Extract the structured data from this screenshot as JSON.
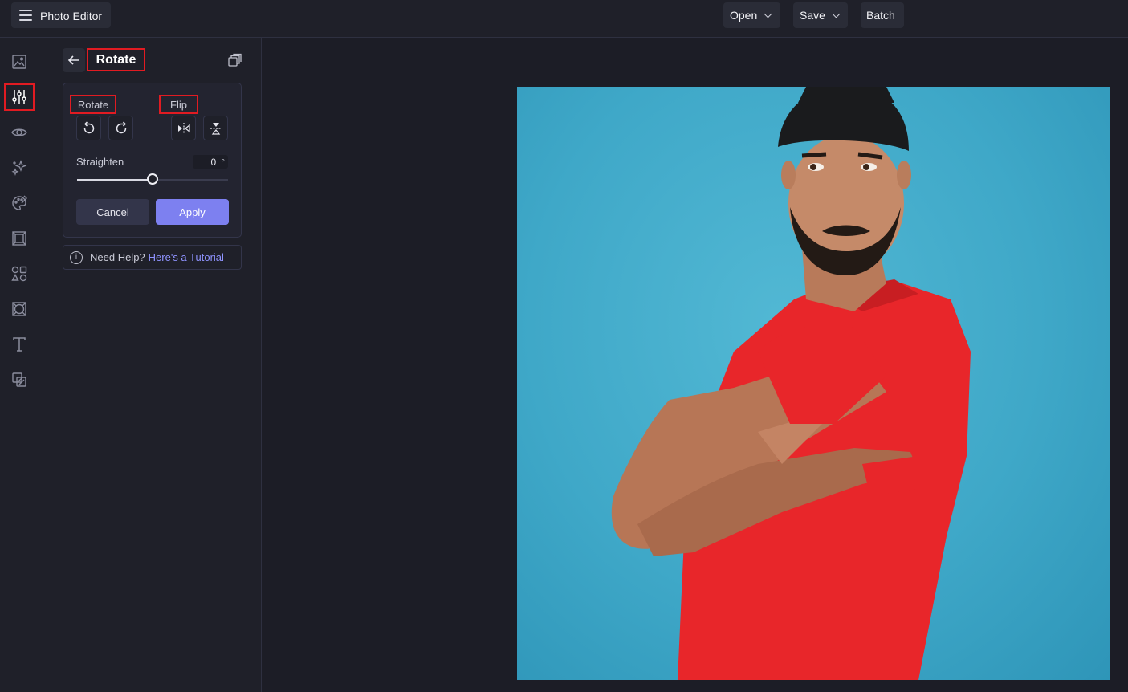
{
  "app": {
    "title": "Photo Editor",
    "menu_icon": "hamburger-icon"
  },
  "toolbar": {
    "open_label": "Open",
    "save_label": "Save",
    "batch_label": "Batch"
  },
  "sidebar": {
    "icons": [
      "image-icon",
      "adjust-sliders-icon",
      "eye-icon",
      "sparkles-icon",
      "palette-icon",
      "frame-icon",
      "shapes-icon",
      "texture-icon",
      "text-icon",
      "layers-icon"
    ],
    "active": "adjust-sliders-icon"
  },
  "panel": {
    "title": "Rotate",
    "rotate_label": "Rotate",
    "flip_label": "Flip",
    "straighten_label": "Straighten",
    "straighten_value": "0",
    "straighten_unit": "°",
    "straighten_level_fraction": 0.5,
    "cancel_label": "Cancel",
    "apply_label": "Apply",
    "help_text": "Need Help?",
    "help_link": "Here's a Tutorial"
  },
  "colors": {
    "accent": "#7d80f0",
    "highlight": "#e11b22",
    "background": "#1c1d26"
  }
}
